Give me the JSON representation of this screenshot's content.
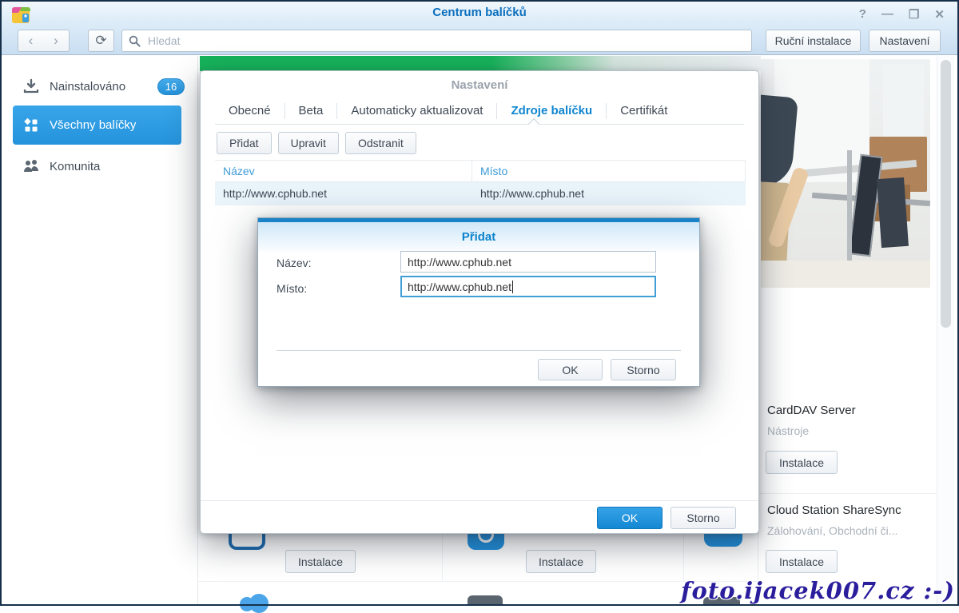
{
  "window": {
    "title": "Centrum balíčků",
    "help": "?",
    "minimize": "—",
    "maximize": "❒",
    "close": "✕"
  },
  "toolbar": {
    "back": "‹",
    "forward": "›",
    "refresh": "⟳",
    "search_placeholder": "Hledat",
    "manual_install_label": "Ruční instalace",
    "settings_label": "Nastavení"
  },
  "sidebar": {
    "installed_label": "Nainstalováno",
    "installed_count": "16",
    "all_packages_label": "Všechny balíčky",
    "community_label": "Komunita"
  },
  "settings_dialog": {
    "title": "Nastavení",
    "tabs": [
      {
        "label": "Obecné"
      },
      {
        "label": "Beta"
      },
      {
        "label": "Automaticky aktualizovat"
      },
      {
        "label": "Zdroje balíčku",
        "active": true
      },
      {
        "label": "Certifikát"
      }
    ],
    "add_label": "Přidat",
    "edit_label": "Upravit",
    "remove_label": "Odstranit",
    "table": {
      "columns": [
        {
          "label": "Název"
        },
        {
          "label": "Místo"
        }
      ],
      "rows": [
        {
          "name": "http://www.cphub.net",
          "location": "http://www.cphub.net"
        }
      ]
    },
    "ok_label": "OK",
    "cancel_label": "Storno"
  },
  "add_dialog": {
    "title": "Přidat",
    "name_label": "Název:",
    "name_value": "http://www.cphub.net",
    "location_label": "Místo:",
    "location_value": "http://www.cphub.net",
    "ok_label": "OK",
    "cancel_label": "Storno"
  },
  "background": {
    "packages": [
      {
        "name": "CardDAV Server",
        "category": "Nástroje",
        "action": "Instalace"
      },
      {
        "name": "Cloud Station ShareSync",
        "category": "Zálohování, Obchodní či...",
        "action": "Instalace"
      }
    ],
    "partial_install_1": "Instalace",
    "partial_install_2": "Instalace"
  },
  "watermark": "foto.ijacek007.cz :-)",
  "colors": {
    "accent_blue": "#2f9fe6",
    "active_tab_blue": "#0e85d0",
    "banner_green": "#16b35a",
    "row_highlight": "#e9f4fb",
    "watermark_blue": "#2b1e9d"
  }
}
